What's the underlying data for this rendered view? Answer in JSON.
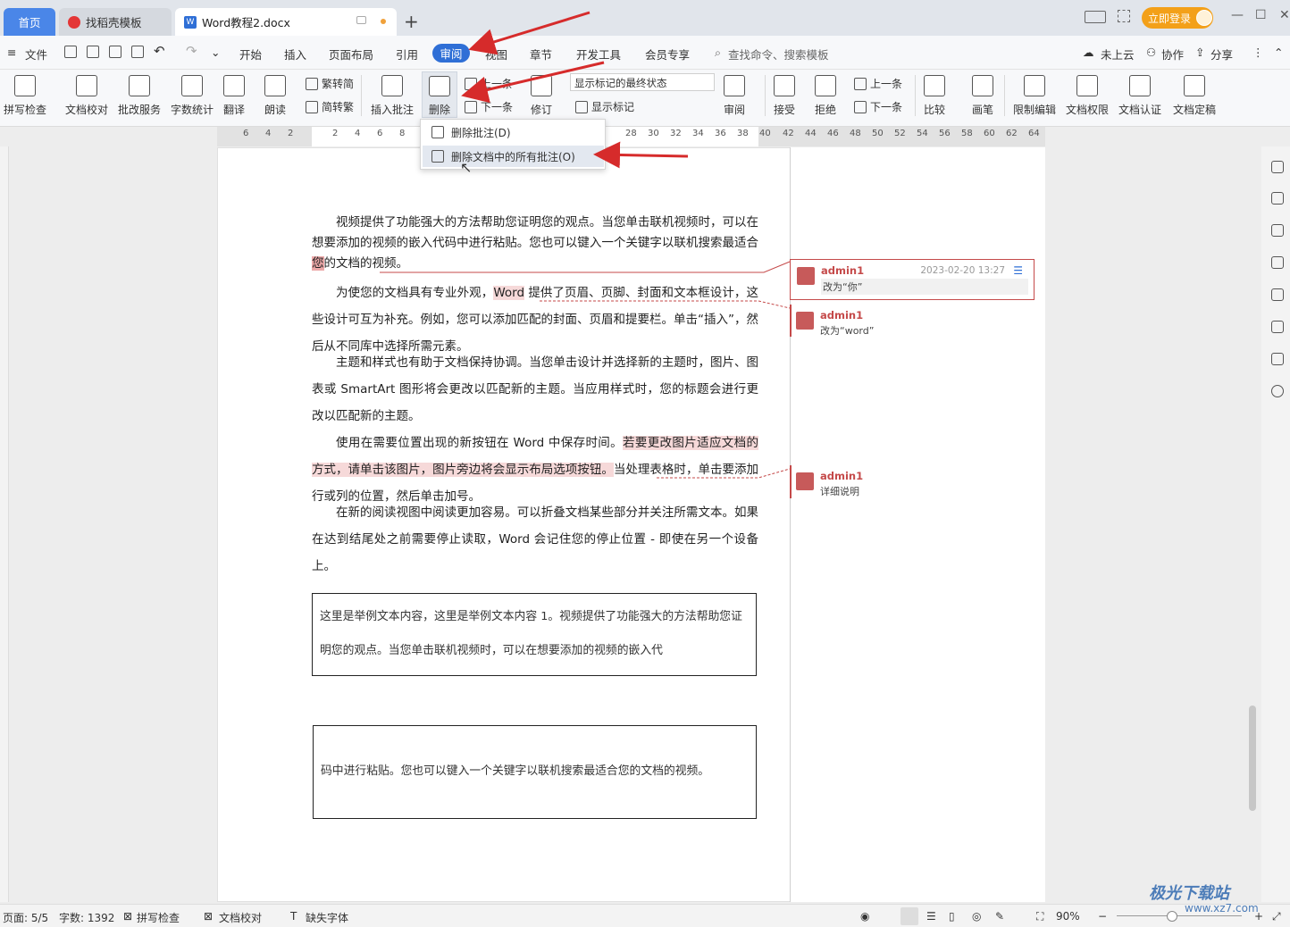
{
  "tabs": [
    {
      "label": "首页"
    },
    {
      "label": "找稻壳模板"
    },
    {
      "label": "Word教程2.docx"
    }
  ],
  "login": "立即登录",
  "window_controls": [
    "—",
    "☐",
    "✕"
  ],
  "menu": {
    "file": "文件",
    "items": [
      "开始",
      "插入",
      "页面布局",
      "引用",
      "审阅",
      "视图",
      "章节",
      "开发工具",
      "会员专享"
    ],
    "active": "审阅",
    "search": "查找命令、搜索模板",
    "cloud": "未上云",
    "collab": "协作",
    "share": "分享"
  },
  "ribbon": {
    "spell": "拼写检查",
    "proofread": "文档校对",
    "batch": "批改服务",
    "wordcount": "字数统计",
    "translate": "翻译",
    "read": "朗读",
    "trad": "繁转简",
    "simp": "简转繁",
    "insert_comment": "插入批注",
    "delete": "删除",
    "prev": "上一条",
    "next": "下一条",
    "revise": "修订",
    "display_mode": "显示标记的最终状态",
    "show_marks": "显示标记",
    "review": "审阅",
    "accept": "接受",
    "reject": "拒绝",
    "prev2": "上一条",
    "next2": "下一条",
    "compare": "比较",
    "pen": "画笔",
    "restrict": "限制编辑",
    "perm": "文档权限",
    "auth": "文档认证",
    "final": "文档定稿"
  },
  "ruler": [
    "6",
    "4",
    "2",
    "2",
    "4",
    "6",
    "8",
    "28",
    "30",
    "32",
    "34",
    "36",
    "38",
    "40",
    "42",
    "44",
    "46",
    "48",
    "50",
    "52",
    "54",
    "56",
    "58",
    "60",
    "62",
    "64"
  ],
  "dropdown": {
    "item1": "删除批注(D)",
    "item2": "删除文档中的所有批注(O)"
  },
  "doc": {
    "p1": [
      "视频提供了功能强大的方法帮助您证明您的观点。当您单击联机视频时，可以在想要添加的视频的嵌入代码中进行粘贴。您也可以键入一个关键字以联机搜索最适合",
      "您",
      "的文档的视频。"
    ],
    "p2": [
      "为使您的文档具有专业外观，",
      "Word",
      " 提供了页眉、页脚、封面和文本框设计，这些设计可互为补充。例如，您可以添加匹配的封面、页眉和提要栏。单击“插入”，然后从不同库中选择所需元素。"
    ],
    "p3": "主题和样式也有助于文档保持协调。当您单击设计并选择新的主题时，图片、图表或 SmartArt 图形将会更改以匹配新的主题。当应用样式时，您的标题会进行更改以匹配新的主题。",
    "p4": [
      "使用在需要位置出现的新按钮在 Word 中保存时间。",
      "若要更改图片适应文档的方式，请单击该图片，图片旁边将会显示布局选项按钮。",
      "当处理表格时，单击要添加行或列的位置，然后单击加号。"
    ],
    "p5": "在新的阅读视图中阅读更加容易。可以折叠文档某些部分并关注所需文本。如果在达到结尾处之前需要停止读取，Word 会记住您的停止位置 - 即使在另一个设备上。",
    "box1": "这里是举例文本内容，这里是举例文本内容 1。视频提供了功能强大的方法帮助您证明您的观点。当您单击联机视频时，可以在想要添加的视频的嵌入代",
    "box2": "码中进行粘贴。您也可以键入一个关键字以联机搜索最适合您的文档的视频。"
  },
  "comments": [
    {
      "author": "admin1",
      "date": "2023-02-20 13:27",
      "text": "改为“你”"
    },
    {
      "author": "admin1",
      "text": "改为“word”"
    },
    {
      "author": "admin1",
      "text": "详细说明"
    }
  ],
  "status": {
    "page": "页面: 5/5",
    "words": "字数: 1392",
    "spell": "拼写检查",
    "proof": "文档校对",
    "font": "缺失字体",
    "zoom": "90%"
  },
  "watermark": {
    "line1": "极光下载站",
    "line2": "www.xz7.com"
  },
  "colors": {
    "accent": "#2f6fd6",
    "comment": "#c54a4a",
    "arrow": "#d62b2b",
    "login": "#f3a019"
  }
}
